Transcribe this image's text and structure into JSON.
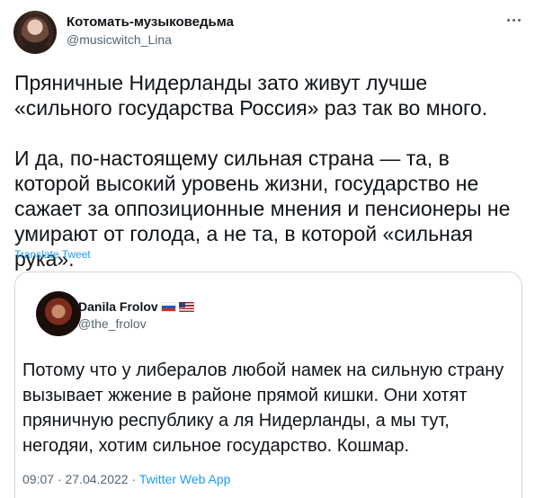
{
  "tweet": {
    "author_name": "Котомать-музыковедьма",
    "author_handle": "@musicwitch_Lina",
    "paragraphs": [
      "Пряничные Нидерланды зато живут лучше «сильного государства Россия» раз так во много.",
      "И да, по-настоящему сильная страна — та, в которой высокий уровень жизни, государство не сажает за оппозиционные мнения и пенсионеры не умирают от голода, а не та, в которой «сильная рука»."
    ],
    "translate_label": "Translate Tweet",
    "more_icon": "more-horizontal-icon"
  },
  "quote": {
    "author_name": "Danila Frolov",
    "author_handle": "@the_frolov",
    "flags": [
      "flag-russia-icon",
      "flag-usa-icon"
    ],
    "text": "Потому что у либералов любой намек на сильную страну вызывает жжение в районе прямой кишки. Они хотят пряничную республику а ля Нидерланды, а мы тут, негодяи, хотим сильное государство. Кошмар.",
    "time": "09:07",
    "date": "27.04.2022",
    "separator": "·",
    "app": "Twitter Web App"
  },
  "colors": {
    "accent": "#1d9bf0",
    "secondary_text": "#536471",
    "border": "#cfd9de"
  }
}
